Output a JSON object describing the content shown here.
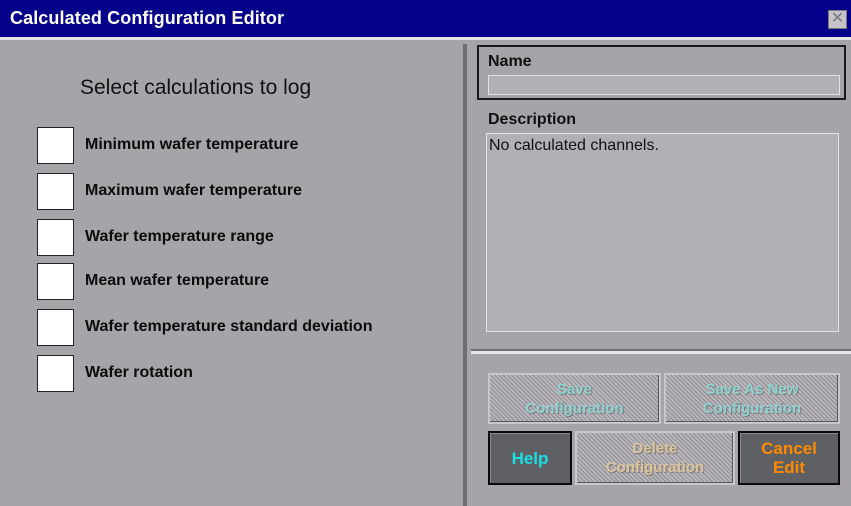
{
  "window": {
    "title": "Calculated Configuration Editor",
    "close_glyph": "✕"
  },
  "calculations": {
    "heading": "Select calculations to log",
    "items": [
      {
        "label": "Minimum wafer temperature",
        "checked": false
      },
      {
        "label": "Maximum wafer temperature",
        "checked": false
      },
      {
        "label": "Wafer temperature range",
        "checked": false
      },
      {
        "label": "Mean wafer temperature",
        "checked": false
      },
      {
        "label": "Wafer temperature standard deviation",
        "checked": false
      },
      {
        "label": "Wafer rotation",
        "checked": false
      }
    ]
  },
  "form": {
    "name_label": "Name",
    "name_value": "",
    "description_label": "Description",
    "description_value": "No calculated channels."
  },
  "buttons": {
    "save_line1": "Save",
    "save_line2": "Configuration",
    "save_as_new_line1": "Save As New",
    "save_as_new_line2": "Configuration",
    "help": "Help",
    "delete_line1": "Delete",
    "delete_line2": "Configuration",
    "cancel_line1": "Cancel",
    "cancel_line2": "Edit"
  },
  "colors": {
    "titlebar": "#05008a",
    "panel": "#a7a4a9",
    "field_bg": "#b3b0b5",
    "help_text": "#19e0e4",
    "cancel_text": "#ff8a00"
  }
}
